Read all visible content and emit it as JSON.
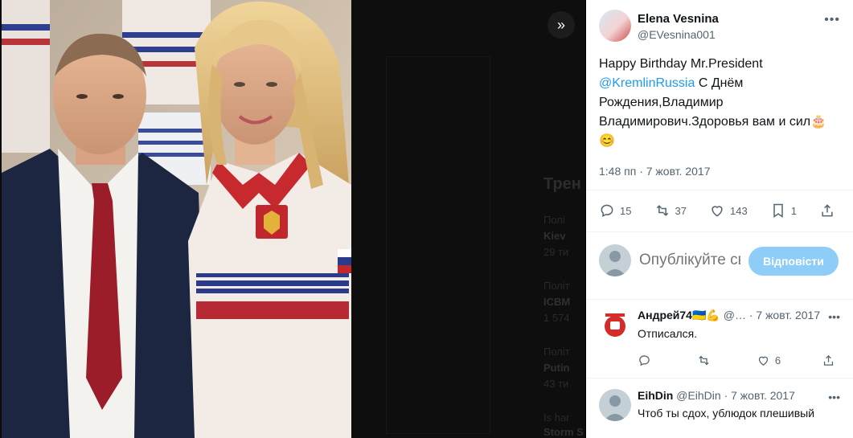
{
  "viewer": {
    "expand_icon": "double-chevron-right-icon",
    "background_text": [
      "Трен",
      "Полі",
      "Kiev",
      "29 ти",
      "Політ",
      "ICBM",
      "1 574",
      "Політ",
      "Putin",
      "43 ти",
      "Is har",
      "Storm S"
    ]
  },
  "author": {
    "display_name": "Elena Vesnina",
    "handle": "@EVesnina001"
  },
  "tweet": {
    "text_lead": "Happy Birthday Mr.President",
    "mention": "@KremlinRussia",
    "text_rest": " С Днём Рождения,Владимир Владимирович.Здоровья вам и сил🎂😊",
    "time": "1:48 пп · 7 жовт. 2017"
  },
  "stats": {
    "replies": "15",
    "retweets": "37",
    "likes": "143",
    "bookmarks": "1"
  },
  "composer": {
    "placeholder": "Опублікуйте свою відповідь",
    "button": "Відповісти"
  },
  "replies": [
    {
      "name": "Андрей74🇺🇦💪",
      "meta": "@… · 7 жовт. 2017",
      "text": "Отписался.",
      "likes": "6"
    },
    {
      "name": "EihDin",
      "meta": "@EihDin · 7 жовт. 2017",
      "text": "Чтоб ты сдох, ублюдок плешивый"
    }
  ],
  "colors": {
    "accent": "#1d9bf0",
    "reply_button": "#8ecdf8",
    "muted": "#536471"
  }
}
